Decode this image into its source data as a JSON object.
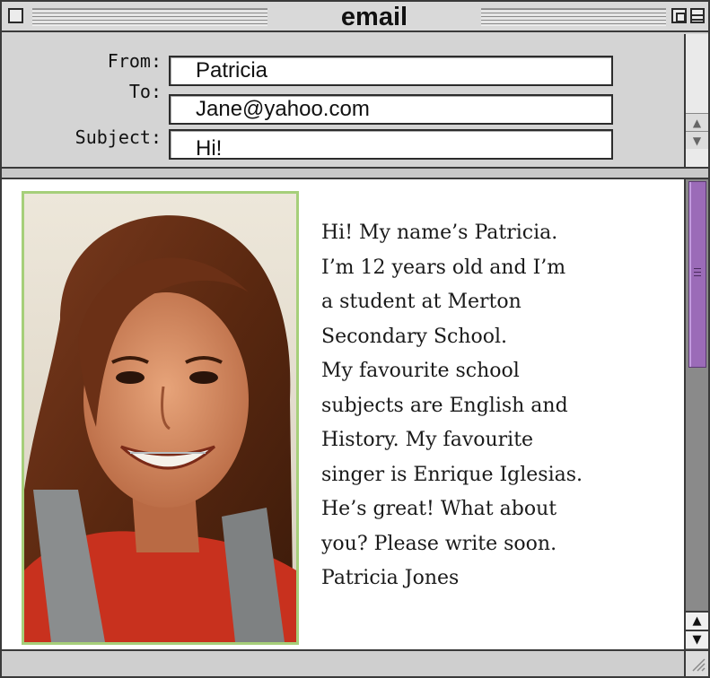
{
  "window": {
    "title": "email"
  },
  "header": {
    "fields": [
      {
        "label": "From:",
        "value": "Patricia"
      },
      {
        "label": "To:",
        "value": "Jane@yahoo.com"
      },
      {
        "label": "Subject:",
        "value": "Hi!"
      }
    ]
  },
  "message": {
    "lines": [
      "Hi! My name’s Patricia.",
      "I’m 12 years old and I’m",
      "a student at Merton",
      "Secondary School.",
      "My favourite school",
      "subjects are English and",
      "History. My favourite",
      "singer is Enrique Iglesias.",
      "He’s great! What about",
      "you? Please write soon.",
      "Patricia Jones"
    ]
  },
  "icons": {
    "close": "close-box-icon",
    "zoom": "zoom-box-icon",
    "collapse": "collapse-box-icon",
    "up": "up-arrow-icon",
    "down": "down-arrow-icon",
    "grow": "resize-grip-icon"
  },
  "colors": {
    "window_chrome": "#d4d4d4",
    "photo_border": "#a6cf7a",
    "scroll_thumb": "#9b6bb8"
  }
}
